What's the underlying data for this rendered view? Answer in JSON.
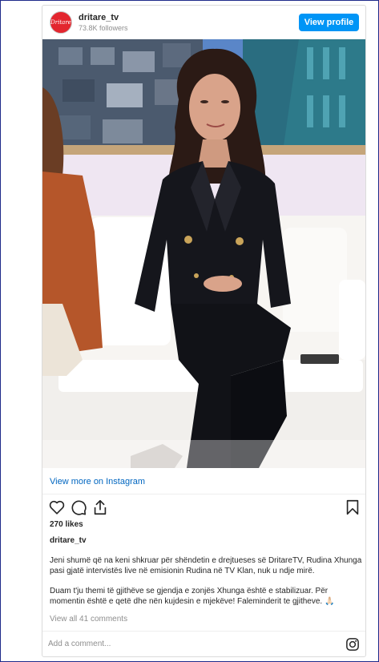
{
  "post": {
    "handle": "dritare_tv",
    "avatar_text": "Dritare",
    "followers": "73.8K followers",
    "view_profile_label": "View profile",
    "image_alt": "Rudina Xhunga",
    "view_more_label": "View more on Instagram",
    "likes": "270 likes",
    "caption_user": "dritare_tv",
    "caption_p1": "Jeni shumë që na keni shkruar për shëndetin e drejtueses së DritareTV, Rudina Xhunga pasi gjatë intervistës live në emisionin Rudina në TV Klan, nuk u ndje mirë.",
    "caption_p2": "Duam t'ju themi të gjithëve se gjendja e zonjës Xhunga është e stabilizuar. Për momentin është e qetë dhe nën kujdesin e mjekëve! Faleminderit te gjitheve. 🙏🏻",
    "view_comments": "View all 41 comments",
    "comment_placeholder": "Add a comment..."
  },
  "icons": [
    "heart-icon",
    "comment-icon",
    "share-icon",
    "bookmark-icon",
    "instagram-icon"
  ],
  "colors": {
    "button_blue": "#0095f6",
    "link_blue": "#0066c0",
    "avatar_red": "#e3262f",
    "muted_text": "#8e8e8e"
  }
}
